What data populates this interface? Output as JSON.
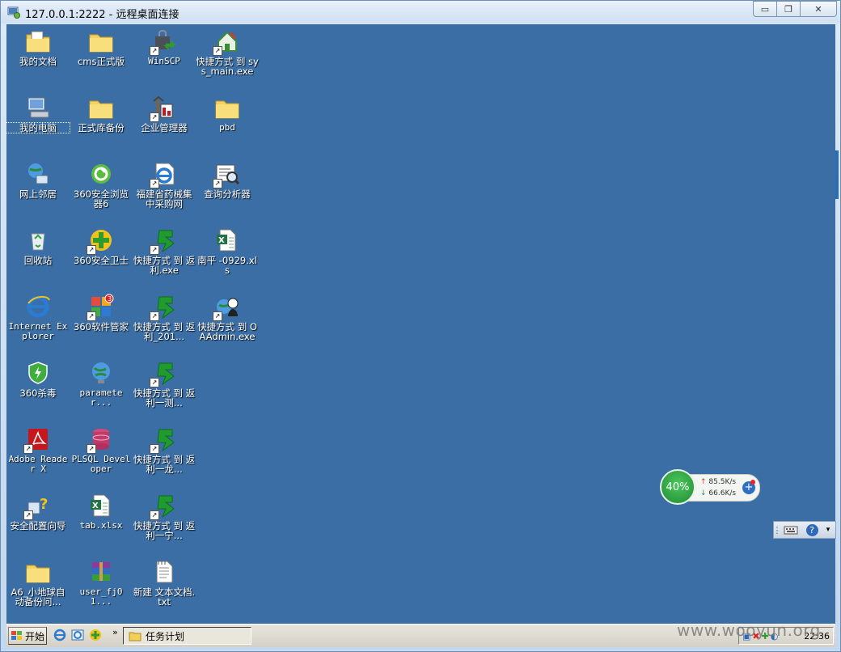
{
  "window": {
    "title": "127.0.0.1:2222 - 远程桌面连接",
    "buttons": {
      "minimize": "▭",
      "restore": "❐",
      "close": "✕"
    }
  },
  "desktop_icons": [
    {
      "label": "我的文档",
      "icon": "my-documents-icon",
      "shortcut": false
    },
    {
      "label": "我的电脑",
      "icon": "my-computer-icon",
      "shortcut": false
    },
    {
      "label": "网上邻居",
      "icon": "network-places-icon",
      "shortcut": false
    },
    {
      "label": "回收站",
      "icon": "recycle-bin-icon",
      "shortcut": false
    },
    {
      "label": "Internet Explorer",
      "icon": "internet-explorer-icon",
      "shortcut": false
    },
    {
      "label": "360杀毒",
      "icon": "antivirus-360-icon",
      "shortcut": false
    },
    {
      "label": "Adobe Reader X",
      "icon": "adobe-reader-icon",
      "shortcut": true
    },
    {
      "label": "安全配置向导",
      "icon": "security-wizard-icon",
      "shortcut": true
    },
    {
      "label": "A6_小地球自动备份问...",
      "icon": "folder-icon",
      "shortcut": false
    },
    {
      "label": "cms正式版",
      "icon": "folder-icon",
      "shortcut": false
    },
    {
      "label": "正式库备份",
      "icon": "folder-icon",
      "shortcut": false
    },
    {
      "label": "360安全浏览器6",
      "icon": "browser-360-icon",
      "shortcut": false
    },
    {
      "label": "360安全卫士",
      "icon": "safeguard-360-icon",
      "shortcut": true
    },
    {
      "label": "360软件管家",
      "icon": "software-manager-360-icon",
      "shortcut": true
    },
    {
      "label": "parameter...",
      "icon": "globe-icon",
      "shortcut": false
    },
    {
      "label": "PLSQL Developer",
      "icon": "plsql-icon",
      "shortcut": true
    },
    {
      "label": "tab.xlsx",
      "icon": "excel-file-icon",
      "shortcut": false
    },
    {
      "label": "user_fj01...",
      "icon": "winrar-archive-icon",
      "shortcut": false
    },
    {
      "label": "WinSCP",
      "icon": "winscp-icon",
      "shortcut": true
    },
    {
      "label": "企业管理器",
      "icon": "enterprise-manager-icon",
      "shortcut": true
    },
    {
      "label": "福建省药械集中采购网",
      "icon": "ie-link-icon",
      "shortcut": true
    },
    {
      "label": "快捷方式 到 返利.exe",
      "icon": "green-arrow-icon",
      "shortcut": true
    },
    {
      "label": "快捷方式 到 返利_201...",
      "icon": "green-arrow-icon",
      "shortcut": true
    },
    {
      "label": "快捷方式 到 返利一测...",
      "icon": "green-arrow-icon",
      "shortcut": true
    },
    {
      "label": "快捷方式 到 返利一龙...",
      "icon": "green-arrow-icon",
      "shortcut": true
    },
    {
      "label": "快捷方式 到 返利一宁...",
      "icon": "green-arrow-icon",
      "shortcut": true
    },
    {
      "label": "新建 文本文档.txt",
      "icon": "text-document-icon",
      "shortcut": false
    },
    {
      "label": "快捷方式 到 sys_main.exe",
      "icon": "house-app-icon",
      "shortcut": true
    },
    {
      "label": "pbd",
      "icon": "folder-icon",
      "shortcut": false
    },
    {
      "label": "查询分析器",
      "icon": "query-analyzer-icon",
      "shortcut": true
    },
    {
      "label": "南平 -0929.xls",
      "icon": "excel-file-icon",
      "shortcut": false
    },
    {
      "label": "快捷方式 到 OAAdmin.exe",
      "icon": "oa-admin-icon",
      "shortcut": true
    }
  ],
  "speed_widget": {
    "percent": "40%",
    "upload": "85.5K/s",
    "download": "66.6K/s"
  },
  "language_bar": {
    "help": "?"
  },
  "taskbar": {
    "start_label": "开始",
    "chevron": "»",
    "task_label": "任务计划",
    "clock": "22:36"
  },
  "watermark": "www.wooyun.org",
  "colors": {
    "desktop": "#3a6ea5",
    "taskbar": "#d4d0c8",
    "titlebar": "#cfe0f2"
  }
}
